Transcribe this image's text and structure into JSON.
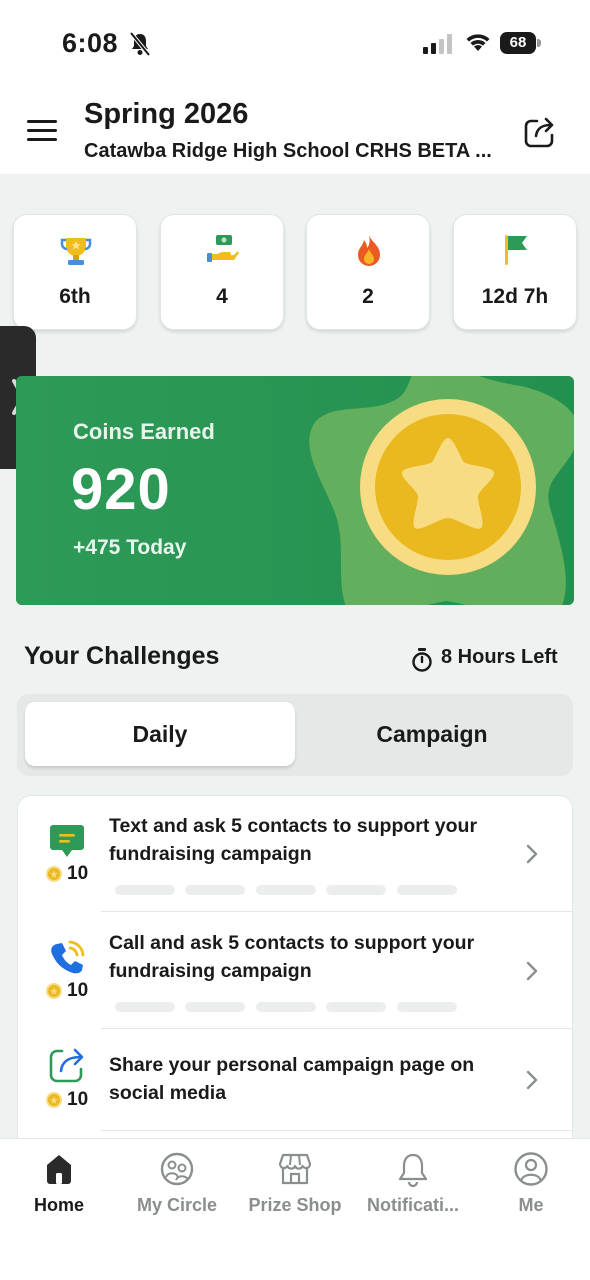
{
  "status_bar": {
    "time": "6:08",
    "battery": "68"
  },
  "header": {
    "title": "Spring 2026",
    "subtitle": "Catawba Ridge High School CRHS BETA ..."
  },
  "stats": [
    {
      "icon": "trophy-icon",
      "value": "6th"
    },
    {
      "icon": "hand-money-icon",
      "value": "4"
    },
    {
      "icon": "flame-icon",
      "value": "2"
    },
    {
      "icon": "flag-icon",
      "value": "12d 7h"
    }
  ],
  "coins": {
    "label": "Coins Earned",
    "value": "920",
    "today": "+475 Today"
  },
  "challenges": {
    "title": "Your Challenges",
    "time_left": "8 Hours Left",
    "tabs": {
      "daily": "Daily",
      "campaign": "Campaign"
    },
    "active_tab": "Daily",
    "items": [
      {
        "icon": "message-icon",
        "points": "10",
        "text": "Text and ask 5 contacts to support your fundraising campaign"
      },
      {
        "icon": "phone-call-icon",
        "points": "10",
        "text": "Call and ask 5 contacts to support your fundraising campaign"
      },
      {
        "icon": "share-icon",
        "points": "10",
        "text": "Share your personal campaign page on social media"
      }
    ]
  },
  "tab_bar": [
    {
      "label": "Home",
      "icon": "home-icon",
      "active": true
    },
    {
      "label": "My Circle",
      "icon": "circle-faces-icon",
      "active": false
    },
    {
      "label": "Prize Shop",
      "icon": "shop-icon",
      "active": false
    },
    {
      "label": "Notificati...",
      "icon": "bell-icon",
      "active": false
    },
    {
      "label": "Me",
      "icon": "person-icon",
      "active": false
    }
  ],
  "colors": {
    "brand_green": "#2e9a57",
    "coin_gold": "#f0bd1f"
  }
}
